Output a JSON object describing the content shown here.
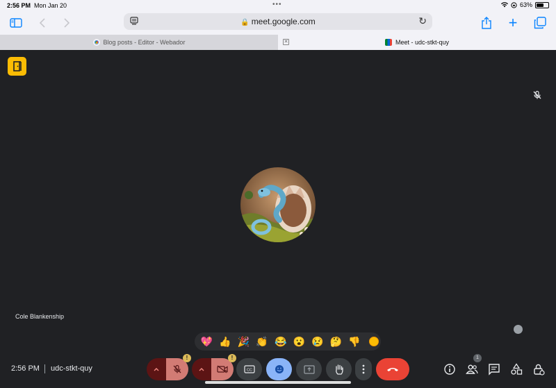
{
  "status_bar": {
    "time": "2:56 PM",
    "date": "Mon Jan 20",
    "battery": "63%",
    "battery_level": 0.63
  },
  "browser": {
    "url": "meet.google.com",
    "tabs": [
      {
        "title": "Blog posts - Editor - Webador",
        "active": false
      },
      {
        "title": "Meet - udc-stkt-quy",
        "active": true
      }
    ]
  },
  "meet": {
    "participant_name": "Cole Blankenship",
    "clock": "2:56 PM",
    "meeting_code": "udc-stkt-quy",
    "participants_count": "1",
    "reactions": [
      "💖",
      "👍",
      "🎉",
      "👏",
      "😂",
      "😮",
      "😢",
      "🤔",
      "👎"
    ],
    "warning_mark": "!",
    "colors": {
      "background": "#202124",
      "end_call": "#ea4335",
      "accent_yellow": "#fbbc04",
      "reaction_active": "#8ab4f8"
    }
  }
}
